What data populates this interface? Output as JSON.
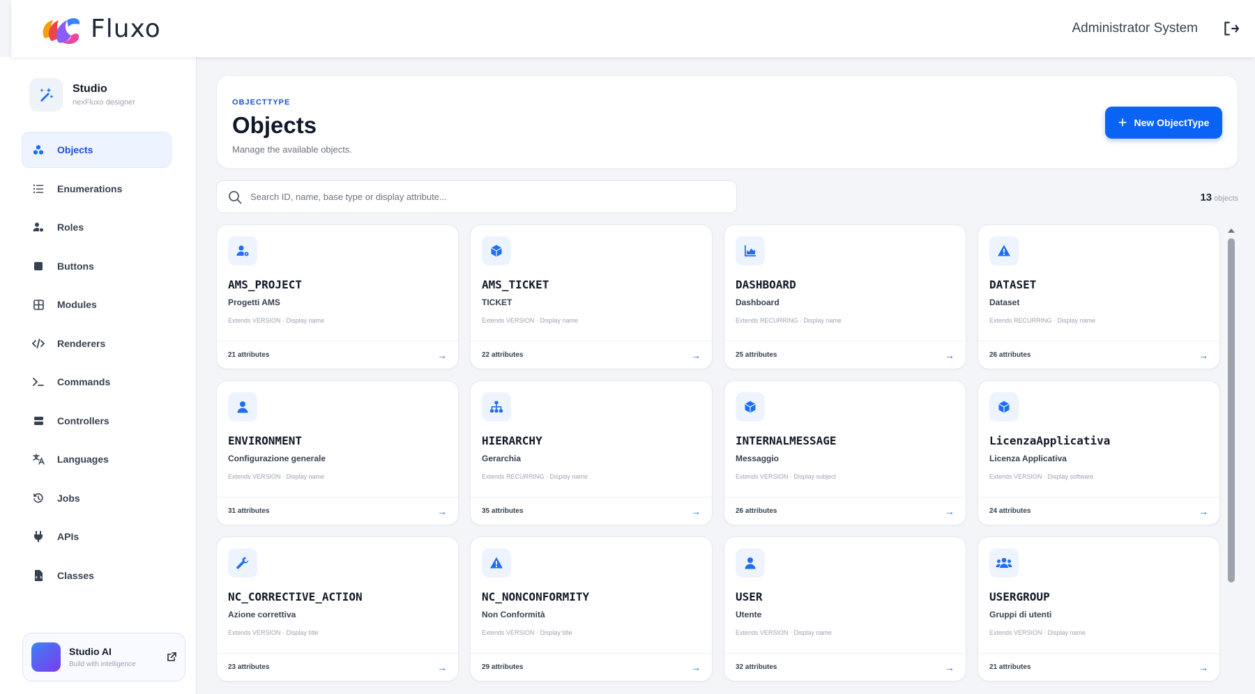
{
  "header": {
    "logo_text": "Fluxo",
    "user_name": "Administrator System"
  },
  "sidebar": {
    "studio_title": "Studio",
    "studio_subtitle": "nexFluxo designer",
    "items": [
      {
        "label": "Objects",
        "icon": "cube-cluster-icon",
        "active": true
      },
      {
        "label": "Enumerations",
        "icon": "list-ordered-icon"
      },
      {
        "label": "Roles",
        "icon": "user-gear-icon"
      },
      {
        "label": "Buttons",
        "icon": "square-icon"
      },
      {
        "label": "Modules",
        "icon": "grid-icon"
      },
      {
        "label": "Renderers",
        "icon": "code-icon"
      },
      {
        "label": "Commands",
        "icon": "terminal-icon"
      },
      {
        "label": "Controllers",
        "icon": "server-icon"
      },
      {
        "label": "Languages",
        "icon": "translate-icon"
      },
      {
        "label": "Jobs",
        "icon": "history-icon"
      },
      {
        "label": "APIs",
        "icon": "plug-icon"
      },
      {
        "label": "Classes",
        "icon": "file-code-icon"
      }
    ],
    "ai": {
      "title": "Studio AI",
      "subtitle": "Build with intelligence"
    }
  },
  "page": {
    "eyebrow": "OBJECTTYPE",
    "title": "Objects",
    "subtitle": "Manage the available objects.",
    "new_button": "New ObjectType",
    "search_placeholder": "Search ID, name, base type or display attribute...",
    "count_value": "13",
    "count_label": "objects"
  },
  "cards": [
    {
      "id": "AMS_PROJECT",
      "name": "Progetti AMS",
      "meta": "Extends VERSION · Display name",
      "attributes": "21 attributes",
      "icon": "user-gear-icon"
    },
    {
      "id": "AMS_TICKET",
      "name": "TICKET",
      "meta": "Extends VERSION · Display name",
      "attributes": "22 attributes",
      "icon": "cube-icon"
    },
    {
      "id": "DASHBOARD",
      "name": "Dashboard",
      "meta": "Extends RECURRING · Display name",
      "attributes": "25 attributes",
      "icon": "area-chart-icon"
    },
    {
      "id": "DATASET",
      "name": "Dataset",
      "meta": "Extends RECURRING · Display name",
      "attributes": "26 attributes",
      "icon": "warning-icon"
    },
    {
      "id": "ENVIRONMENT",
      "name": "Configurazione generale",
      "meta": "Extends VERSION · Display name",
      "attributes": "31 attributes",
      "icon": "user-icon"
    },
    {
      "id": "HIERARCHY",
      "name": "Gerarchia",
      "meta": "Extends RECURRING · Display name",
      "attributes": "35 attributes",
      "icon": "sitemap-icon"
    },
    {
      "id": "INTERNALMESSAGE",
      "name": "Messaggio",
      "meta": "Extends VERSION · Display subject",
      "attributes": "26 attributes",
      "icon": "cube-icon"
    },
    {
      "id": "LicenzaApplicativa",
      "name": "Licenza Applicativa",
      "meta": "Extends VERSION · Display software",
      "attributes": "24 attributes",
      "icon": "cube-icon"
    },
    {
      "id": "NC_CORRECTIVE_ACTION",
      "name": "Azione correttiva",
      "meta": "Extends VERSION · Display title",
      "attributes": "23 attributes",
      "icon": "wrench-icon"
    },
    {
      "id": "NC_NONCONFORMITY",
      "name": "Non Conformità",
      "meta": "Extends VERSION · Display title",
      "attributes": "29 attributes",
      "icon": "warning-icon"
    },
    {
      "id": "USER",
      "name": "Utente",
      "meta": "Extends VERSION · Display name",
      "attributes": "32 attributes",
      "icon": "user-icon"
    },
    {
      "id": "USERGROUP",
      "name": "Gruppi di utenti",
      "meta": "Extends VERSION · Display name",
      "attributes": "21 attributes",
      "icon": "users-icon"
    }
  ],
  "colors": {
    "accent": "#0b63f6",
    "icon_blue": "#1d6ff2",
    "sidebar_active_bg": "#eef4ff"
  }
}
